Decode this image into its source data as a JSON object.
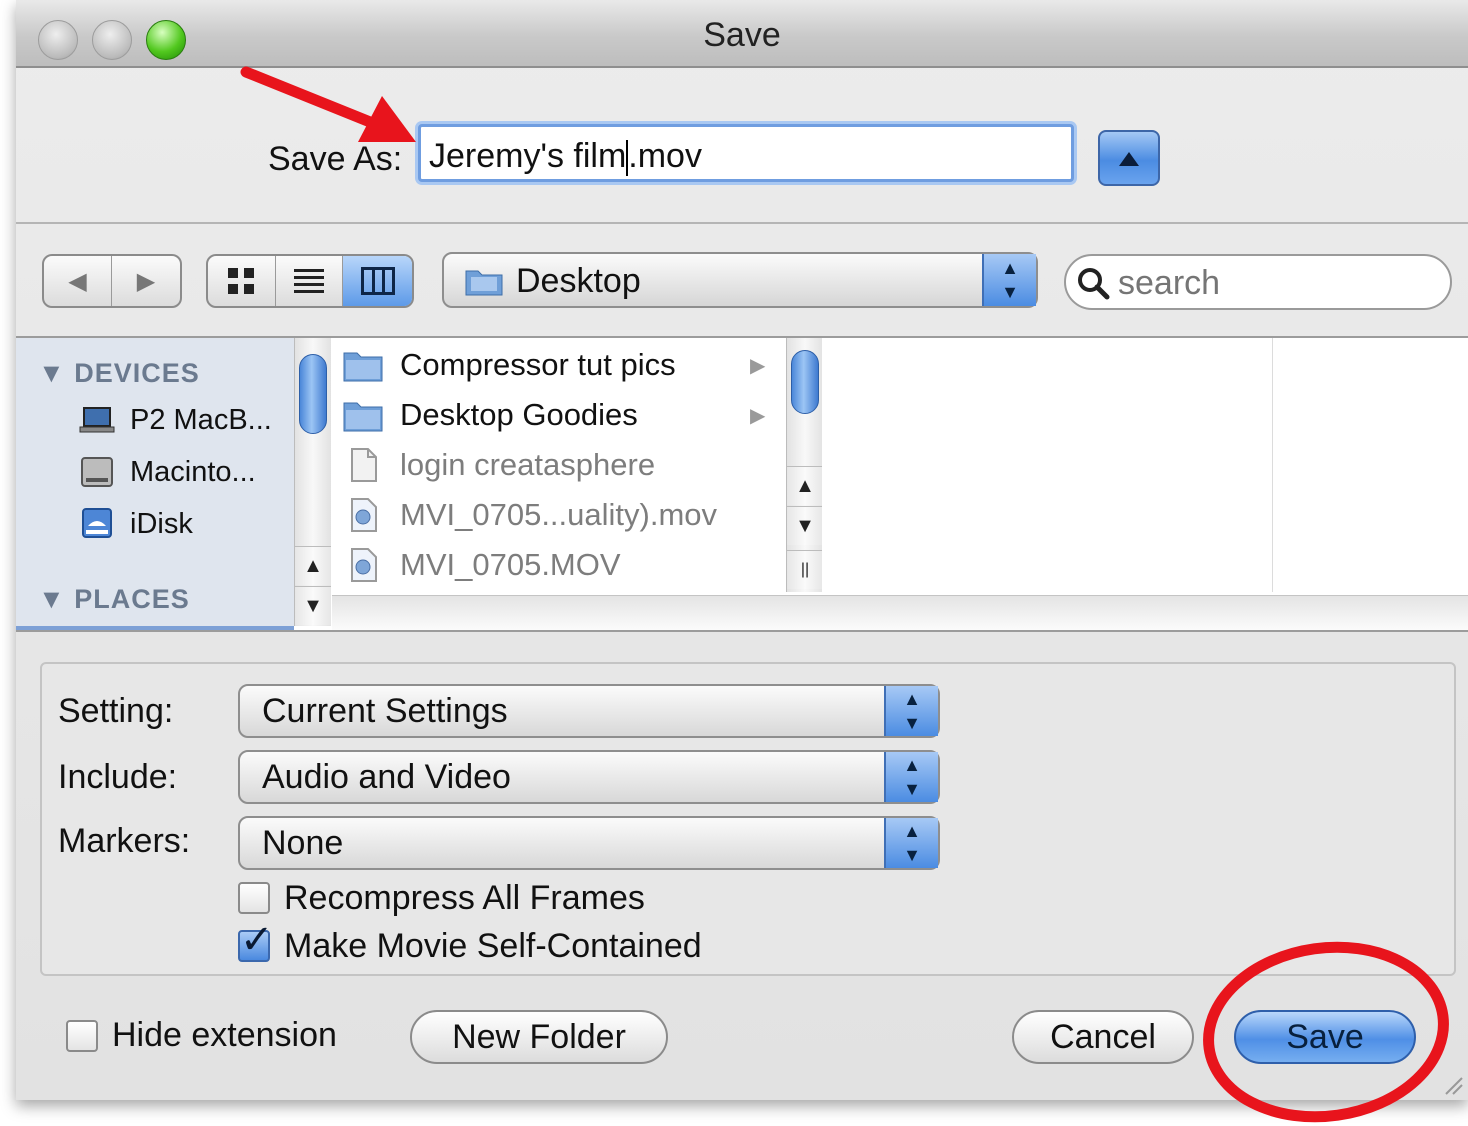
{
  "window": {
    "title": "Save"
  },
  "save_as": {
    "label": "Save As:",
    "value_before_cursor": "Jeremy's film",
    "value_after_cursor": ".mov"
  },
  "toolbar": {
    "back_glyph": "◀",
    "forward_glyph": "▶",
    "view_icons": [
      "icon-view-icon",
      "list-view-icon",
      "column-view-icon"
    ],
    "location": "Desktop",
    "search_placeholder": "search"
  },
  "sidebar": {
    "devices_header": "DEVICES",
    "devices": [
      {
        "label": "P2 MacB...",
        "icon": "laptop-icon"
      },
      {
        "label": "Macinto...",
        "icon": "hard-drive-icon"
      },
      {
        "label": "iDisk",
        "icon": "idisk-icon"
      }
    ],
    "places_header": "PLACES"
  },
  "files": [
    {
      "name": "Compressor tut pics",
      "type": "folder",
      "has_children": true,
      "dimmed": false
    },
    {
      "name": "Desktop Goodies",
      "type": "folder",
      "has_children": true,
      "dimmed": false
    },
    {
      "name": "login creatasphere",
      "type": "document",
      "has_children": false,
      "dimmed": true
    },
    {
      "name": "MVI_0705...uality).mov",
      "type": "movie",
      "has_children": false,
      "dimmed": true
    },
    {
      "name": "MVI_0705.MOV",
      "type": "movie",
      "has_children": false,
      "dimmed": true
    }
  ],
  "options": {
    "setting": {
      "label": "Setting:",
      "value": "Current Settings"
    },
    "include": {
      "label": "Include:",
      "value": "Audio and Video"
    },
    "markers": {
      "label": "Markers:",
      "value": "None"
    },
    "recompress": {
      "label": "Recompress All Frames",
      "checked": false
    },
    "self_contained": {
      "label": "Make Movie Self-Contained",
      "checked": true
    }
  },
  "buttons": {
    "hide_extension": {
      "label": "Hide extension",
      "checked": false
    },
    "new_folder": "New Folder",
    "cancel": "Cancel",
    "save": "Save"
  },
  "colors": {
    "accent": "#4b8ce2",
    "annotation": "#e8141c"
  }
}
